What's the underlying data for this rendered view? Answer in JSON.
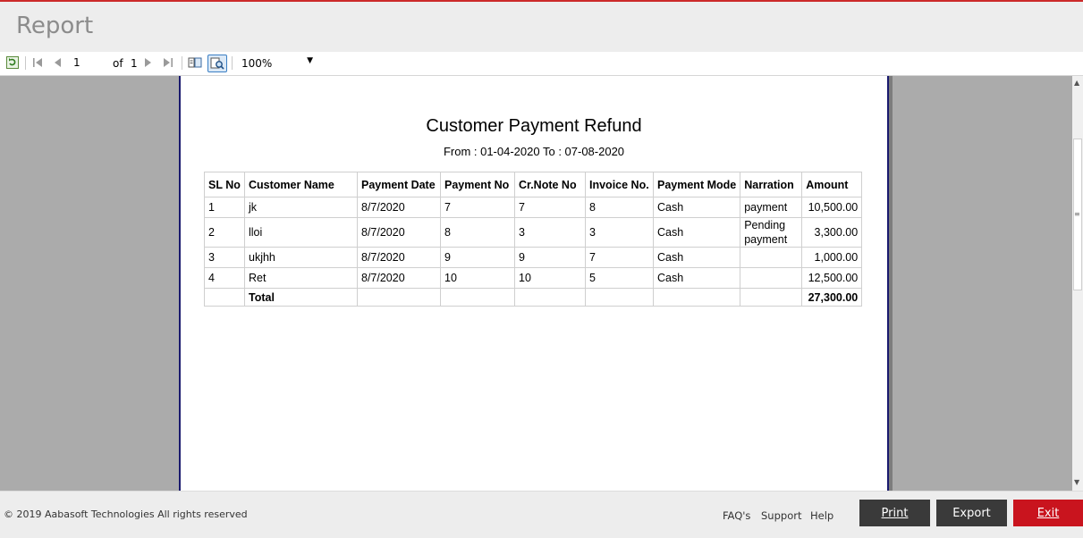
{
  "app": {
    "title": "Report"
  },
  "toolbar": {
    "current_page": "1",
    "of_label": "of",
    "total_pages": "1",
    "zoom": "100%",
    "icons": [
      "refresh-icon",
      "first-page-icon",
      "previous-page-icon",
      "next-page-icon",
      "last-page-icon",
      "document-map-icon",
      "find-icon"
    ]
  },
  "report": {
    "title": "Customer Payment Refund",
    "range": "From : 01-04-2020 To : 07-08-2020",
    "columns": [
      "SL No",
      "Customer Name",
      "Payment Date",
      "Payment No",
      "Cr.Note No",
      "Invoice No.",
      "Payment Mode",
      "Narration",
      "Amount"
    ],
    "rows": [
      [
        "1",
        "jk",
        "8/7/2020",
        "7",
        "7",
        "8",
        "Cash",
        "payment",
        "10,500.00"
      ],
      [
        "2",
        "lloi",
        "8/7/2020",
        "8",
        "3",
        "3",
        "Cash",
        "Pending payment",
        "3,300.00"
      ],
      [
        "3",
        "ukjhh",
        "8/7/2020",
        "9",
        "9",
        "7",
        "Cash",
        "",
        "1,000.00"
      ],
      [
        "4",
        "Ret",
        "8/7/2020",
        "10",
        "10",
        "5",
        "Cash",
        "",
        "12,500.00"
      ]
    ],
    "total": {
      "label": "Total",
      "amount": "27,300.00"
    }
  },
  "footer": {
    "copyright": "© 2019 Aabasoft Technologies All rights reserved",
    "links": {
      "faq": "FAQ's",
      "support": "Support",
      "help": "Help"
    },
    "buttons": {
      "print": "Print",
      "export": "Export",
      "exit": "Exit"
    }
  },
  "colors": {
    "accent_red": "#c9141e",
    "button_dark": "#3a3a3a",
    "page_border": "#1a1a6e",
    "viewer_bg": "#ababab"
  }
}
